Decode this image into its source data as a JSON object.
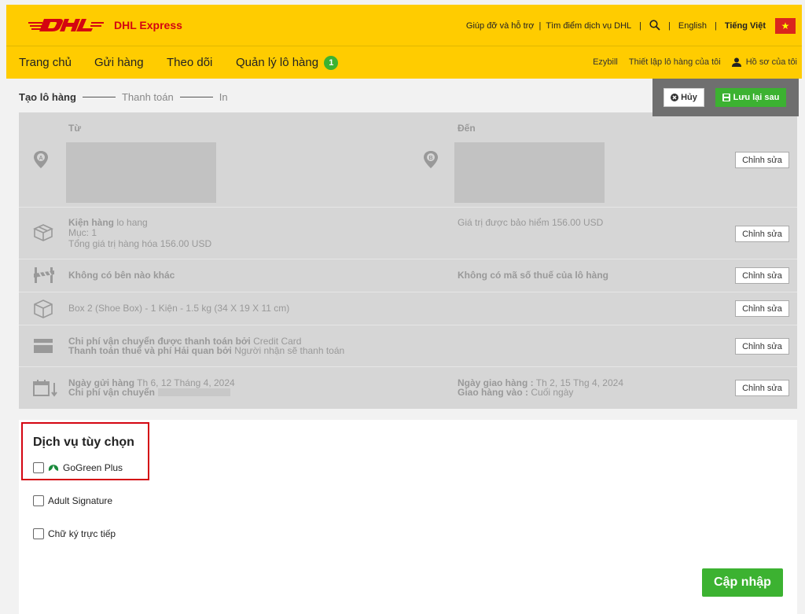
{
  "header": {
    "brand": "DHL Express",
    "links": [
      "Giúp đỡ và hỗ trợ",
      "Tìm điểm dịch vụ DHL"
    ],
    "lang_en": "English",
    "lang_vi": "Tiếng Việt",
    "separator": "|"
  },
  "nav": {
    "items": [
      "Trang chủ",
      "Gửi hàng",
      "Theo dõi",
      "Quản lý lô hàng"
    ],
    "badge": "1",
    "right": [
      "Ezybill",
      "Thiết lập lô hàng của tôi",
      "Hồ sơ của tôi"
    ]
  },
  "steps": [
    "Tạo lô hàng",
    "Thanh toán",
    "In"
  ],
  "actions": {
    "cancel": "Hủy",
    "save": "Lưu lại sau"
  },
  "summary": {
    "from_label": "Từ",
    "to_label": "Đến",
    "edit_label": "Chỉnh sửa",
    "package": {
      "title_bold": "Kiện hàng",
      "title_rest": " lo hang",
      "item": "Mục: 1",
      "total": "Tổng giá trị hàng hóa 156.00 USD",
      "insured": "Giá trị được bảo hiểm 156.00 USD"
    },
    "parties": {
      "left": "Không có bên nào khác",
      "right": "Không có mã số thuế của lô hàng"
    },
    "box": "Box 2 (Shoe Box) - 1 Kiện - 1.5 kg (34 X 19 X 11 cm)",
    "payment": {
      "line1_bold": "Chi phí vận chuyển được thanh toán bởi",
      "line1_val": " Credit Card",
      "line2_bold": "Thanh toán thuế và phí Hải quan bởi",
      "line2_val": " Người nhận sẽ thanh toán"
    },
    "dates": {
      "ship_bold": "Ngày gửi hàng",
      "ship_val": " Th 6, 12 Tháng 4, 2024",
      "cost_bold": "Chi phí vận chuyển",
      "deliver_bold": "Ngày giao hàng :",
      "deliver_val": " Th 2, 15 Thg 4, 2024",
      "deliver_by_bold": "Giao hàng vào :",
      "deliver_by_val": " Cuối ngày"
    }
  },
  "options": {
    "title": "Dịch vụ tùy chọn",
    "items": [
      "GoGreen Plus",
      "Adult Signature",
      "Chữ ký trực tiếp"
    ],
    "update": "Cập nhập"
  },
  "colors": {
    "dhl_yellow": "#ffcc00",
    "dhl_red": "#d40511",
    "green": "#3cb231"
  }
}
